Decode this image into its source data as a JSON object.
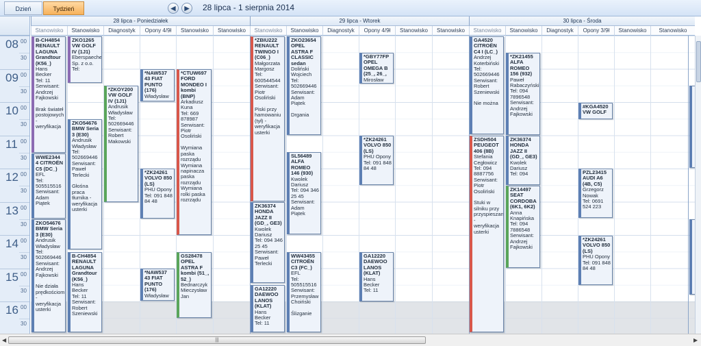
{
  "toolbar": {
    "tab_day": "Dzień",
    "tab_week": "Tydzień",
    "prev_glyph": "◀",
    "next_glyph": "▶",
    "range_title": "28 lipca - 1 sierpnia 2014"
  },
  "days": [
    {
      "label": "28 lipca - Poniedziałek",
      "columns": [
        "Stanowisko",
        "Stanowisko",
        "Diagnostyk",
        "Opony 4/9ł",
        "Stanowisko",
        "Stanowisko"
      ]
    },
    {
      "label": "29 lipca - Wtorek",
      "columns": [
        "Stanowisko",
        "Stanowisko",
        "Diagnostyk",
        "Opony 4/9ł",
        "Stanowisko",
        "Stanowisko"
      ]
    },
    {
      "label": "30 lipca - Środa",
      "columns": [
        "Stanowisko",
        "Stanowisko",
        "Diagnostyk",
        "Opony 3/9ł",
        "Stanowisko",
        "Stanowisko"
      ]
    }
  ],
  "hours": [
    "08",
    "09",
    "10",
    "11",
    "12",
    "13",
    "14",
    "15",
    "16"
  ],
  "minute_labels": [
    "00",
    "30"
  ],
  "colors": {
    "accent_tab": "#f7b25b",
    "header": "#dde8f5",
    "appt_border": "#5d7fb3",
    "alert": "#d8574a"
  },
  "appointments": [
    {
      "title": "B-CH4854 RENAULT LAGUNA Grandtour (K56_)",
      "body": "Hans Becker\nTel: 11\nSerwisant: Andrzej Fajkowski\n\nBrak świateł postojowych - weryfikacja",
      "color": "violet"
    },
    {
      "title": "WWE2344 4 CITROËN C5 (DC_)",
      "body": "EFL\nTel: 505515516\nSerwisant: Adam Piątek",
      "color": "default"
    },
    {
      "title": "ZKO54676 BMW Seria 3 (E30)",
      "body": "Andrusik Władysław\nTel: 502669446\nSerwisant: Andrzej Fajkowski\n\nNie działa prędkościomierz - weryfikacja usterki",
      "color": "default"
    },
    {
      "title": "ZKO1265 VW GOLF IV (1J1)",
      "body": "Eberspaecher Sp. z o.o.\nTel:",
      "color": "violet"
    },
    {
      "title": "ZKO54676 BMW Seria 3 (E30)",
      "body": "Andrusik Władysław\nTel: 502669446\nSerwisant: Paweł Terlecki\n\nGłośna praca tłumika - weryfikacja usterki",
      "color": "default"
    },
    {
      "title": "B-CH4854 RENAULT LAGUNA Grandtour (K56_)",
      "body": "Hans Becker\nTel: 11\nSerwisant: Robert Szeniewski",
      "color": "default"
    },
    {
      "title": "*ZKOY200 VW GOLF IV (1J1)",
      "body": "Andrusik Władysław\nTel: 502669446\nSerwisant: Robert Makowski",
      "color": "green"
    },
    {
      "title": "*NAW537 43 FIAT PUNTO (176)",
      "body": "Władysław",
      "color": "default"
    },
    {
      "title": "*ZK24261 VOLVO 850 (LS)",
      "body": "PHU Opony\nTel: 091 848 84 48",
      "color": "default"
    },
    {
      "title": "*NAW537 43 FIAT PUNTO (176)",
      "body": "Władysław",
      "color": "default"
    },
    {
      "title": "*CTUW697 FORD MONDEO I kombi (BNP)",
      "body": "Arkadiusz Kuna\nTel: 669 878987\nSerwisant: Piotr Osoliński\n\nWymiana paska rozrządu Wymiana napinacza paska rozrządu Wymiana rolki paska rozrządu",
      "color": "red"
    },
    {
      "title": "GS28478 OPEL ASTRA F kombi (51_, 52_)",
      "body": "Bednarczyk Mieczysław Jan",
      "color": "green"
    },
    {
      "title": "*ZBIU222 RENAULT TWINGO I (C06_)",
      "body": "Małgorzata Margosz\nTel: 600544544\nSerwisant: Piotr Osoliński\n\nPiski przy hamowaniu (tył) - weryfikacja usterki",
      "color": "red"
    },
    {
      "title": "ZK36374 HONDA JAZZ II (GD_, GE3)",
      "body": "Kwolek Dariusz\nTel: 094 346 25 45\nSerwisant: Paweł Terlecki",
      "color": "default"
    },
    {
      "title": "GA12220 DAEWOO LANOS (KLAT)",
      "body": "Hans Becker\nTel: 11",
      "color": "default"
    },
    {
      "title": "ZKO23654 OPEL ASTRA F CLASSIC sedan",
      "body": "Doliński Wojciech\nTel: 502669446\nSerwisant: Adam Piątek\n\nDrgania",
      "color": "default"
    },
    {
      "title": "SL56489 ALFA ROMEO 146 (930)",
      "body": "Kwolek Dariusz\nTel: 094 346 25 45\nSerwisant: Adam Piątek",
      "color": "default"
    },
    {
      "title": "WW43455 CITROËN C3 (FC_)",
      "body": "EFL\nTel: 505515516\nSerwisant: Przemysław Choiński\n\nŚlizganie",
      "color": "default"
    },
    {
      "title": "*GBY77FP OPEL OMEGA B (25_, 26_,",
      "body": "Mirosław",
      "color": "default"
    },
    {
      "title": "*ZK24261 VOLVO 850 (LS)",
      "body": "PHU Opony\nTel: 091 848 84 48",
      "color": "default"
    },
    {
      "title": "GA12220 DAEWOO LANOS (KLAT)",
      "body": "Hans Becker\nTel: 11",
      "color": "default"
    },
    {
      "title": "GA4520 CITROËN C4 I (LC_)",
      "body": "Andrzej Koterbiński\nTel: 502669446\nSerwisant: Robert Szeniewski\n\nNie można",
      "color": "default"
    },
    {
      "title": "ZSDH504 PEUGEOT 406 (8B)",
      "body": "Stefania Cegłowicz\nTel: 094 8887756\nSerwisant: Piotr Osoliński\n\nStuki w silniku przy przyspieszaniu - weryfikacja usterki",
      "color": "red"
    },
    {
      "title": "*ZK21455 ALFA ROMEO 156 (932)",
      "body": "Paweł Rabaczyński\nTel: 094 7896548\nSerwisant: Andrzej Fajkowski",
      "color": "default"
    },
    {
      "title": "ZK36374 HONDA JAZZ II (GD_, GE3)",
      "body": "Kwolek Dariusz\nTel: 094",
      "color": "default"
    },
    {
      "title": "ZK14497 SEAT CORDOBA (6K1, 6K2)",
      "body": "Anna Knapińska\nTel: 094 7886548\nSerwisant: Andrzej Fajkowski",
      "color": "green"
    },
    {
      "title": "#KGA4520 VW GOLF",
      "body": "",
      "color": "default"
    },
    {
      "title": "PZL23415 AUDI A6 (4B, C5)",
      "body": "Grzegorz Nowak\nTel: 0691 524 223",
      "color": "default"
    },
    {
      "title": "*ZK24261 VOLVO 850 (LS)",
      "body": "PHU Opony\nTel: 091 848 84 48",
      "color": "default"
    }
  ],
  "scrollbar": {
    "grip": "|||"
  }
}
